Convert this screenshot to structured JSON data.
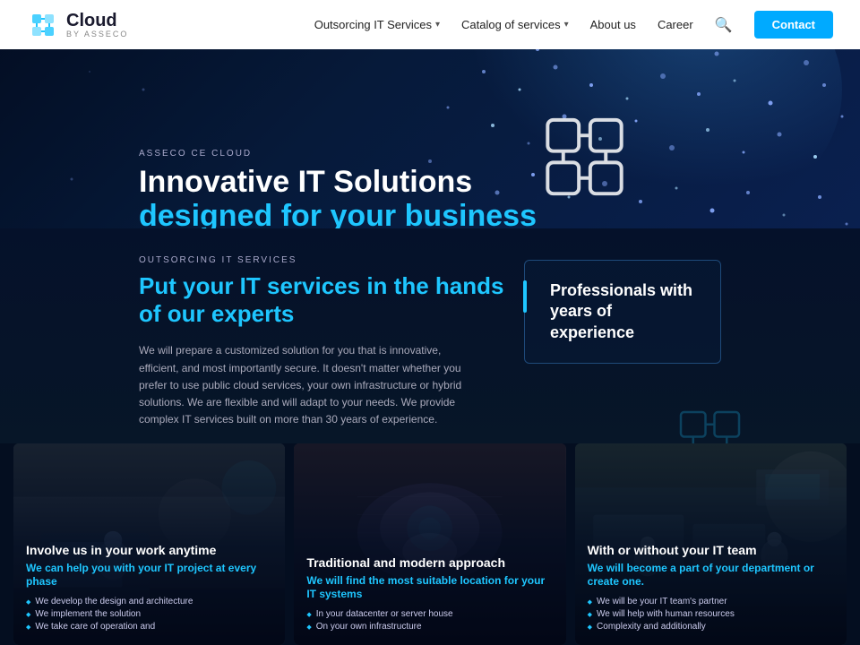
{
  "nav": {
    "logo_text": "Cloud",
    "logo_sub": "by asseco",
    "links": [
      {
        "label": "Outsorcing IT Services",
        "has_dropdown": true
      },
      {
        "label": "Catalog of services",
        "has_dropdown": true
      },
      {
        "label": "About us",
        "has_dropdown": false
      },
      {
        "label": "Career",
        "has_dropdown": false
      }
    ],
    "contact_label": "Contact"
  },
  "hero": {
    "eyebrow": "ASSECO CE CLOUD",
    "title_line1": "Innovative IT Solutions",
    "title_line2": "designed for your business"
  },
  "section2": {
    "eyebrow": "OUTSORCING IT SERVICES",
    "title_line1": "Put your IT services in the hands",
    "title_line2": "of our ",
    "title_accent": "experts",
    "body": "We will prepare a customized solution for you that is innovative, efficient, and most importantly secure. It doesn't matter whether you prefer to use public cloud services, your own infrastructure or hybrid solutions. We are flexible and will adapt to your needs. We provide complex IT services built on more than 30 years of experience.",
    "quote": "Professionals with years of experience"
  },
  "cards": [
    {
      "title": "Involve us in your work anytime",
      "subtitle": "We can help you with your IT project at every phase",
      "bullets": [
        "We develop the design and architecture",
        "We implement the solution",
        "We take care of operation and"
      ]
    },
    {
      "title": "Traditional and modern approach",
      "subtitle": "We will find the most suitable location for your IT systems",
      "bullets": [
        "In your datacenter or server house",
        "On your own infrastructure"
      ]
    },
    {
      "title": "With or without your IT team",
      "subtitle": "We will become a part of your department or create one.",
      "bullets": [
        "We will be your IT team's partner",
        "We will help with human resources",
        "Complexity and additionally"
      ]
    }
  ]
}
